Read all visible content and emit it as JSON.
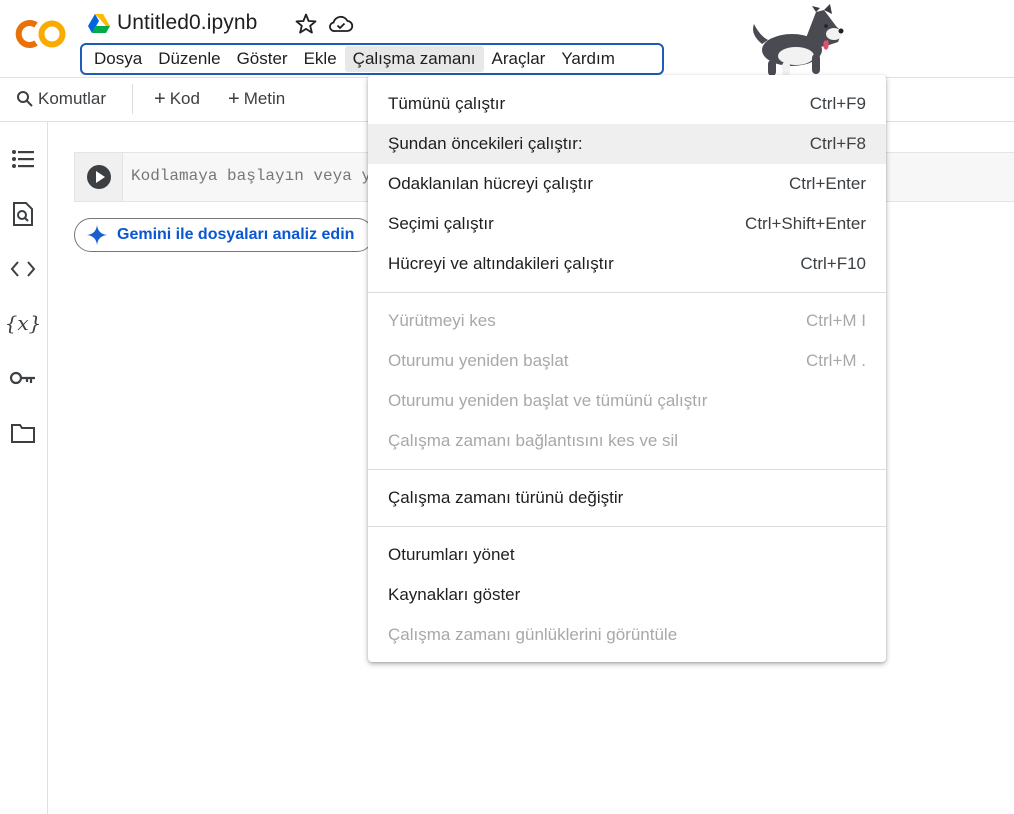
{
  "header": {
    "logo_text": "CO",
    "title": "Untitled0.ipynb"
  },
  "menubar": [
    {
      "label": "Dosya",
      "active": false
    },
    {
      "label": "Düzenle",
      "active": false
    },
    {
      "label": "Göster",
      "active": false
    },
    {
      "label": "Ekle",
      "active": false
    },
    {
      "label": "Çalışma zamanı",
      "active": true
    },
    {
      "label": "Araçlar",
      "active": false
    },
    {
      "label": "Yardım",
      "active": false
    }
  ],
  "toolbar": {
    "commands_label": "Komutlar",
    "add_code_label": "Kod",
    "add_text_label": "Metin"
  },
  "sidebar": {
    "icons": [
      "table-of-contents-icon",
      "find-icon",
      "code-snippets-icon",
      "variables-icon",
      "secrets-key-icon",
      "folder-icon"
    ]
  },
  "cell": {
    "placeholder": "Kodlamaya başlayın veya y"
  },
  "gemini": {
    "label": "Gemini ile dosyaları analiz edin"
  },
  "runtime_menu": {
    "items": [
      {
        "label": "Tümünü çalıştır",
        "shortcut": "Ctrl+F9",
        "disabled": false,
        "hover": false
      },
      {
        "label": "Şundan öncekileri çalıştır:",
        "shortcut": "Ctrl+F8",
        "disabled": false,
        "hover": true
      },
      {
        "label": "Odaklanılan hücreyi çalıştır",
        "shortcut": "Ctrl+Enter",
        "disabled": false,
        "hover": false
      },
      {
        "label": "Seçimi çalıştır",
        "shortcut": "Ctrl+Shift+Enter",
        "disabled": false,
        "hover": false
      },
      {
        "label": "Hücreyi ve altındakileri çalıştır",
        "shortcut": "Ctrl+F10",
        "disabled": false,
        "hover": false
      },
      {
        "separator": true
      },
      {
        "label": "Yürütmeyi kes",
        "shortcut": "Ctrl+M I",
        "disabled": true,
        "hover": false
      },
      {
        "label": "Oturumu yeniden başlat",
        "shortcut": "Ctrl+M .",
        "disabled": true,
        "hover": false
      },
      {
        "label": "Oturumu yeniden başlat ve tümünü çalıştır",
        "shortcut": "",
        "disabled": true,
        "hover": false
      },
      {
        "label": "Çalışma zamanı bağlantısını kes ve sil",
        "shortcut": "",
        "disabled": true,
        "hover": false
      },
      {
        "separator": true
      },
      {
        "label": "Çalışma zamanı türünü değiştir",
        "shortcut": "",
        "disabled": false,
        "hover": false
      },
      {
        "separator": true
      },
      {
        "label": "Oturumları yönet",
        "shortcut": "",
        "disabled": false,
        "hover": false
      },
      {
        "label": "Kaynakları göster",
        "shortcut": "",
        "disabled": false,
        "hover": false
      },
      {
        "label": "Çalışma zamanı günlüklerini görüntüle",
        "shortcut": "",
        "disabled": true,
        "hover": false
      }
    ]
  },
  "colors": {
    "accent_blue": "#1d5cb9",
    "gemini_blue": "#0b57d0",
    "logo_orange": "#f9ab00",
    "logo_dark_orange": "#e8710a"
  }
}
